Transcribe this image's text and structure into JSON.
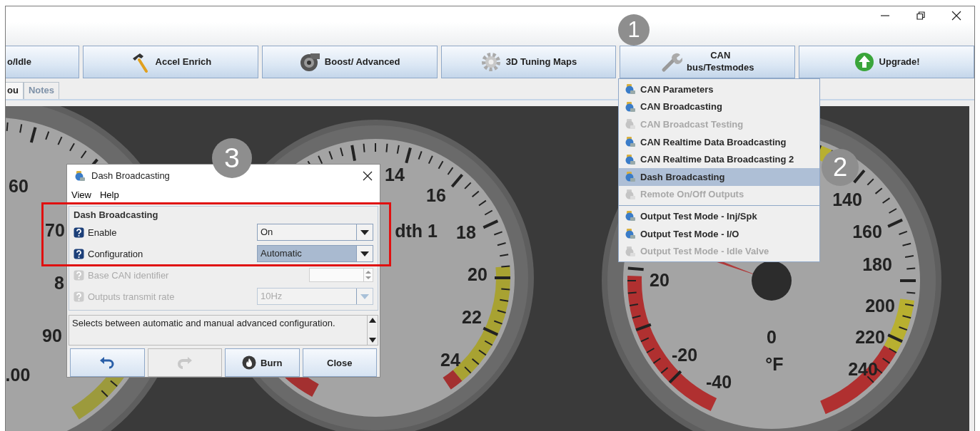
{
  "toolbar": [
    {
      "label": "o/Idle"
    },
    {
      "label": "Accel Enrich"
    },
    {
      "label": "Boost/ Advanced"
    },
    {
      "label": "3D Tuning Maps"
    },
    {
      "label": "CAN\nbus/Testmodes"
    },
    {
      "label": "Upgrade!"
    }
  ],
  "tabs": [
    {
      "label": "ou",
      "selected": true
    },
    {
      "label": "Notes",
      "selected": false
    }
  ],
  "gauges": [
    {
      "labels": [
        "60",
        "70",
        "8",
        "90",
        ".00"
      ]
    },
    {
      "labels": [
        "14",
        "16",
        "dth 1",
        "18",
        "20",
        "22",
        "24"
      ]
    },
    {
      "labels": [
        "140",
        "160",
        "180",
        "20",
        "200",
        "0",
        "220",
        "-20",
        "°F",
        "240",
        "-40"
      ]
    }
  ],
  "menu": {
    "items": [
      {
        "kind": "item",
        "label": "CAN Parameters",
        "disabled": false,
        "selected": false
      },
      {
        "kind": "item",
        "label": "CAN Broadcasting",
        "disabled": false,
        "selected": false
      },
      {
        "kind": "item",
        "label": "CAN Broadcast Testing",
        "disabled": true,
        "selected": false
      },
      {
        "kind": "item",
        "label": "CAN Realtime Data Broadcasting",
        "disabled": false,
        "selected": false
      },
      {
        "kind": "item",
        "label": "CAN Realtime Data Broadcasting 2",
        "disabled": false,
        "selected": false
      },
      {
        "kind": "item",
        "label": "Dash Broadcasting",
        "disabled": false,
        "selected": true
      },
      {
        "kind": "item",
        "label": "Remote On/Off Outputs",
        "disabled": true,
        "selected": false
      },
      {
        "kind": "separator"
      },
      {
        "kind": "item",
        "label": "Output Test Mode - Inj/Spk",
        "disabled": false,
        "selected": false
      },
      {
        "kind": "item",
        "label": "Output Test Mode - I/O",
        "disabled": false,
        "selected": false
      },
      {
        "kind": "item",
        "label": "Output Test Mode - Idle Valve",
        "disabled": true,
        "selected": false
      }
    ]
  },
  "dialog": {
    "title": "Dash Broadcasting",
    "menu": [
      "View",
      "Help"
    ],
    "group": "Dash Broadcasting",
    "fields": [
      {
        "kind": "combo",
        "label": "Enable",
        "value": "On",
        "disabled": false,
        "selected": false
      },
      {
        "kind": "combo",
        "label": "Configuration",
        "value": "Automatic",
        "disabled": false,
        "selected": true
      },
      {
        "kind": "spinner",
        "label": "Base CAN identifier",
        "disabled": true,
        "selected": false
      },
      {
        "kind": "combo",
        "label": "Outputs transmit rate",
        "value": "10Hz",
        "disabled": true,
        "selected": false
      }
    ],
    "description": "Selects between automatic and manual advanced configuration.",
    "buttons": [
      {
        "kind": "undo",
        "disabled": false
      },
      {
        "kind": "redo",
        "disabled": true
      },
      {
        "kind": "burn",
        "label": "Burn",
        "disabled": false
      },
      {
        "kind": "text",
        "label": "Close",
        "disabled": false
      }
    ]
  },
  "callouts": [
    "1",
    "2",
    "3"
  ]
}
